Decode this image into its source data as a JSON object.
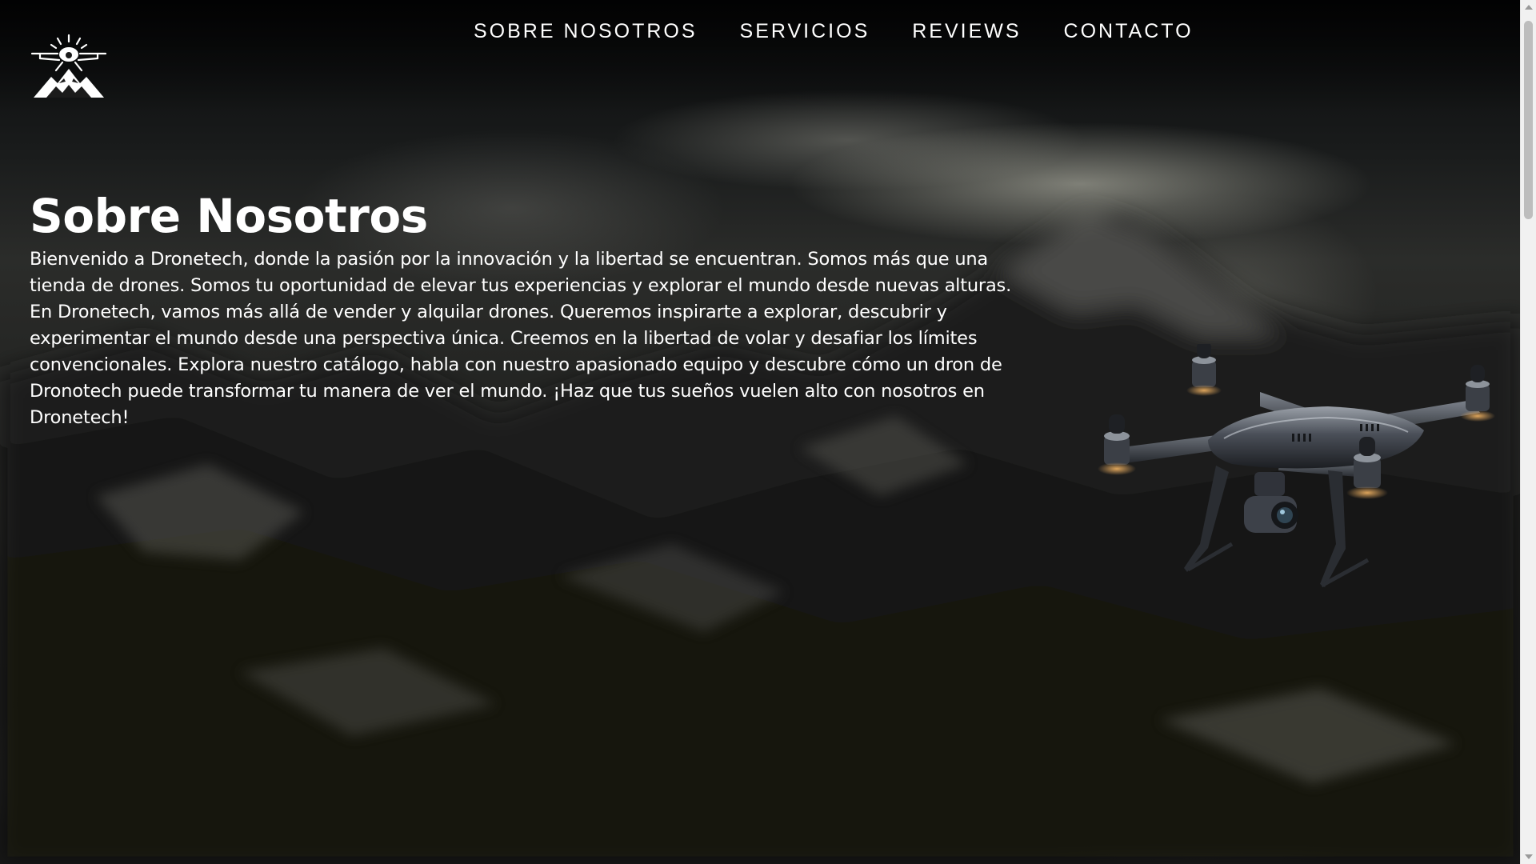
{
  "nav": {
    "items": [
      {
        "label": "SOBRE NOSOTROS"
      },
      {
        "label": "SERVICIOS"
      },
      {
        "label": "REVIEWS"
      },
      {
        "label": "CONTACTO"
      }
    ]
  },
  "about": {
    "title": "Sobre Nosotros",
    "body": "Bienvenido a Dronetech, donde la pasión por la innovación y la libertad se encuentran. Somos más que una tienda de drones. Somos tu oportunidad de elevar tus experiencias y explorar el mundo desde nuevas alturas. En Dronetech, vamos más allá de vender y alquilar drones. Queremos inspirarte a explorar, descubrir y experimentar el mundo desde una perspectiva única. Creemos en la libertad de volar y desafiar los límites convencionales. Explora nuestro catálogo, habla con nuestro apasionado equipo y descubre cómo un dron de Dronotech puede transformar tu manera de ver el mundo. ¡Haz que tus sueños vuelen alto con nosotros en Dronetech!"
  },
  "icons": {
    "logo": "drone-mountain-logo-icon",
    "hero_image": "quadcopter-drone-image"
  },
  "colors": {
    "text": "#ffffff",
    "background": "#1a1b1a"
  }
}
